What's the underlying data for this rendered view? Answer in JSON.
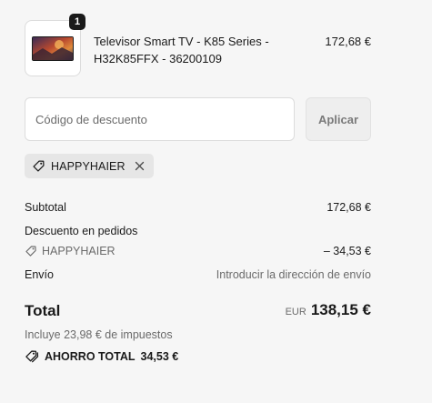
{
  "product": {
    "quantity": "1",
    "title": "Televisor Smart TV - K85 Series - H32K85FFX - 36200109",
    "price": "172,68 €",
    "image_icon": "tv-product-thumbnail"
  },
  "discount": {
    "placeholder": "Código de descuento",
    "apply_label": "Aplicar",
    "applied_code": "HAPPYHAIER"
  },
  "summary": {
    "subtotal_label": "Subtotal",
    "subtotal_value": "172,68 €",
    "order_discount_label": "Descuento en pedidos",
    "discount_code": "HAPPYHAIER",
    "discount_value": "– 34,53 €",
    "shipping_label": "Envío",
    "shipping_value": "Introducir la dirección de envío"
  },
  "total": {
    "label": "Total",
    "currency": "EUR",
    "amount": "138,15 €",
    "taxes_note": "Incluye 23,98 € de impuestos",
    "savings_label": "AHORRO TOTAL",
    "savings_amount": "34,53 €"
  },
  "colors": {
    "background": "#f6f6f6",
    "text": "#1a1a1a",
    "muted": "#6b6b6b",
    "chip": "#e6e6e6"
  }
}
